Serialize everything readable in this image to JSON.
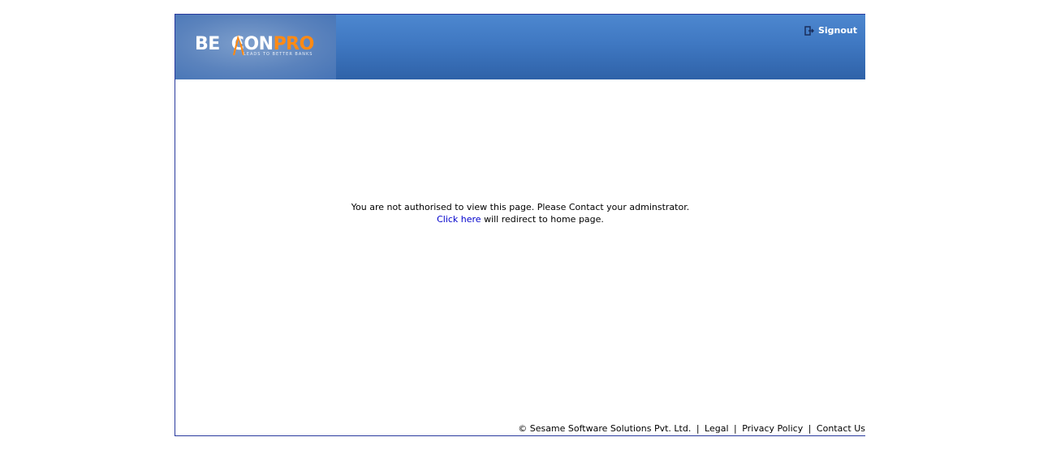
{
  "header": {
    "logo": {
      "part_a": "BE",
      "part_a2": "CON",
      "part_b": "PRO",
      "tagline": "LEADS TO BETTER BANKS"
    },
    "signout_label": "Signout",
    "signout_icon": "signout-icon"
  },
  "message": {
    "line1": "You are not authorised to view this page. Please Contact your adminstrator.",
    "link_label": "Click here",
    "line2_rest": " will redirect to home page."
  },
  "footer": {
    "copyright": "© Sesame Software Solutions Pvt. Ltd.",
    "separator": "|",
    "links": [
      "Legal",
      "Privacy Policy",
      "Contact Us"
    ]
  },
  "colors": {
    "header_blue": "#3f78c2",
    "logo_orange": "#ff8a14",
    "link_blue": "#0000cc",
    "frame_border": "#2a3a9e"
  }
}
